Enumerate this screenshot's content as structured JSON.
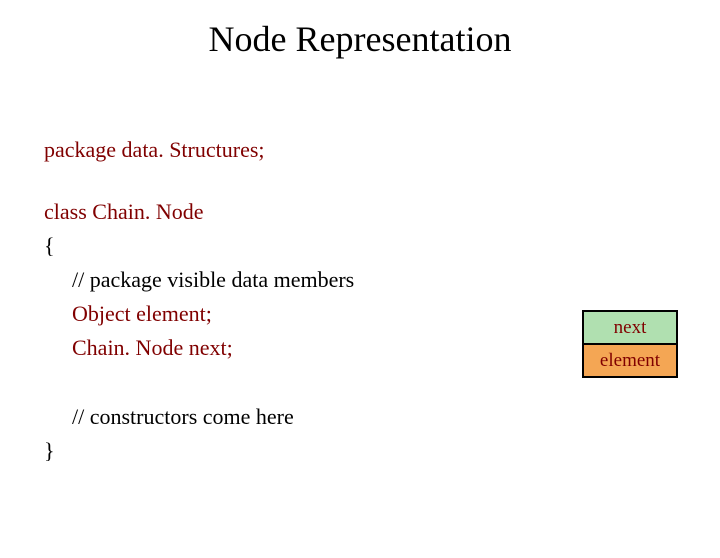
{
  "title": "Node Representation",
  "code": {
    "package_line": "package data. Structures;",
    "class_line": "class Chain. Node",
    "open_brace": "{",
    "comment_members": "// package visible data members",
    "member1": "Object element;",
    "member2": "Chain. Node next;",
    "comment_ctor": "// constructors come here",
    "close_brace": "}"
  },
  "diagram": {
    "top": "next",
    "bottom": "element"
  }
}
